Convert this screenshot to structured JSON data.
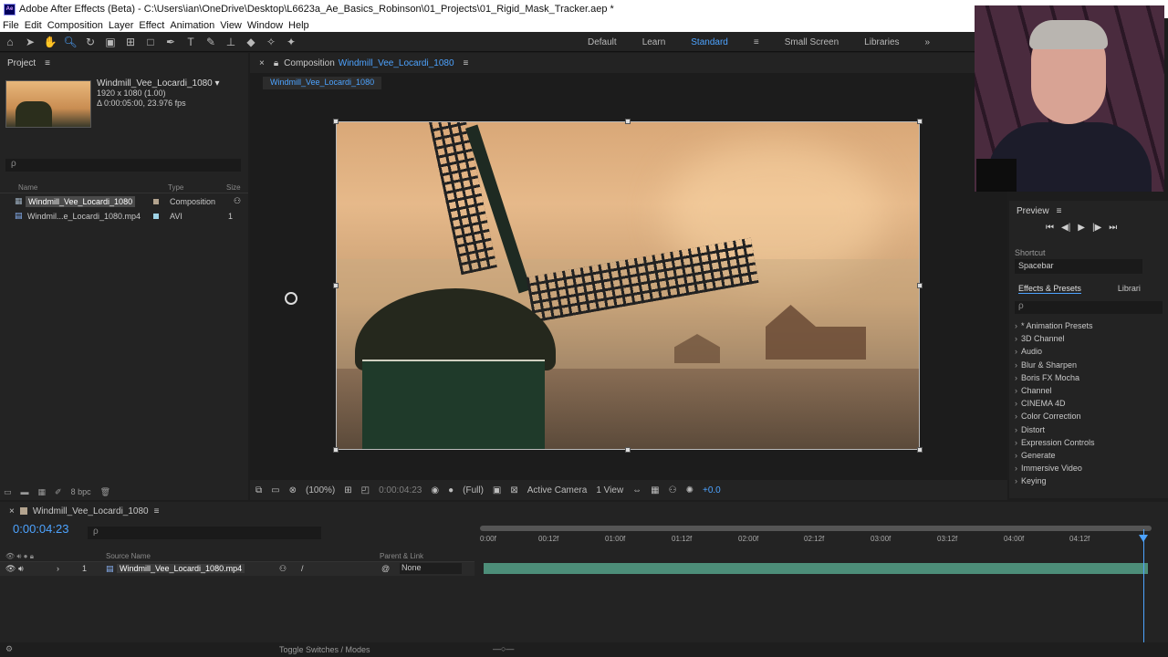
{
  "window": {
    "title": "Adobe After Effects (Beta) - C:\\Users\\ian\\OneDrive\\Desktop\\L6623a_Ae_Basics_Robinson\\01_Projects\\01_Rigid_Mask_Tracker.aep *",
    "app_icon": "Ae"
  },
  "menu": [
    "File",
    "Edit",
    "Composition",
    "Layer",
    "Effect",
    "Animation",
    "View",
    "Window",
    "Help"
  ],
  "workspaces": [
    {
      "label": "Default",
      "active": false
    },
    {
      "label": "Learn",
      "active": false
    },
    {
      "label": "Standard",
      "active": true
    },
    {
      "label": "Small Screen",
      "active": false
    },
    {
      "label": "Libraries",
      "active": false
    }
  ],
  "project": {
    "title": "Project",
    "item_name": "Windmill_Vee_Locardi_1080 ▾",
    "item_res": "1920 x 1080 (1.00)",
    "item_duration": "Δ 0:00:05:00, 23.976 fps",
    "search_placeholder": "ρ",
    "columns": {
      "name": "Name",
      "type": "Type",
      "size": "Size"
    },
    "rows": [
      {
        "name": "Windmill_Vee_Locardi_1080",
        "type": "Composition",
        "size": ""
      },
      {
        "name": "Windmil...e_Locardi_1080.mp4",
        "type": "AVI",
        "size": "1"
      }
    ],
    "bpc": "8 bpc"
  },
  "composition": {
    "tab_prefix": "Composition",
    "tab_name": "Windmill_Vee_Locardi_1080",
    "breadcrumb": "Windmill_Vee_Locardi_1080",
    "zoom": "(100%)",
    "timecode": "0:00:04:23",
    "resolution": "(Full)",
    "camera": "Active Camera",
    "views": "1 View",
    "exposure": "+0.0"
  },
  "preview": {
    "title": "Preview",
    "shortcut_label": "Shortcut",
    "shortcut_value": "Spacebar"
  },
  "effects": {
    "tab_active": "Effects & Presets",
    "tab_other": "Librari",
    "search_placeholder": "ρ",
    "items": [
      "* Animation Presets",
      "3D Channel",
      "Audio",
      "Blur & Sharpen",
      "Boris FX Mocha",
      "Channel",
      "CINEMA 4D",
      "Color Correction",
      "Distort",
      "Expression Controls",
      "Generate",
      "Immersive Video",
      "Keying"
    ]
  },
  "timeline": {
    "comp_name": "Windmill_Vee_Locardi_1080",
    "timecode": "0:00:04:23",
    "search_placeholder": "ρ",
    "col_source": "Source Name",
    "col_parent": "Parent & Link",
    "layer_number": "1",
    "layer_name": "Windmill_Vee_Locardi_1080.mp4",
    "parent_value": "None",
    "ticks": [
      "0:00f",
      "00:12f",
      "01:00f",
      "01:12f",
      "02:00f",
      "02:12f",
      "03:00f",
      "03:12f",
      "04:00f",
      "04:12f"
    ],
    "toggle_label": "Toggle Switches / Modes"
  }
}
